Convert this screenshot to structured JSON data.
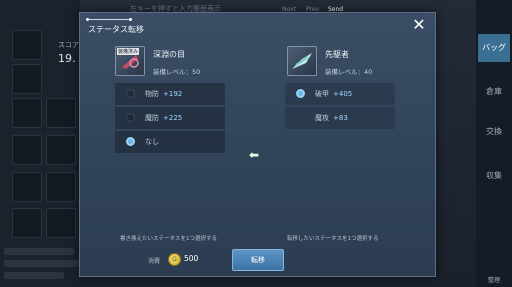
{
  "background": {
    "hint_text": "左キーを押すと入力履歴表示",
    "nav": [
      "Next",
      "Prev",
      "Send"
    ],
    "score_label": "スコア",
    "score_value": "19.",
    "tabs": [
      "バッグ",
      "倉庫",
      "交換",
      "収集"
    ],
    "footer_label": "整理"
  },
  "dialog": {
    "title": "ステータス転移",
    "close_icon": "close-icon",
    "source_item": {
      "badge": "装備済み",
      "name": "深淵の目",
      "level_text": "装備レベル：50",
      "stats": [
        {
          "name": "物防",
          "value": "+192",
          "selected": false
        },
        {
          "name": "魔防",
          "value": "+225",
          "selected": false
        },
        {
          "name": "なし",
          "value": "",
          "selected": true
        }
      ]
    },
    "target_item": {
      "name": "先駆者",
      "level_text": "装備レベル：40",
      "stats": [
        {
          "name": "破甲",
          "value": "+405",
          "selected": true
        },
        {
          "name": "魔攻",
          "value": "+83",
          "selected": false
        }
      ]
    },
    "arrow_icon": "arrow-left-icon",
    "source_hint": "書き換えたいステータスを1つ選択する",
    "target_hint": "転移したいステータスを1つ選択する",
    "cost_label": "消費",
    "cost_value": "500",
    "confirm_label": "転移",
    "colors": {
      "accent": "#4a86b8",
      "selected_radio": "#6bb7e8"
    }
  }
}
